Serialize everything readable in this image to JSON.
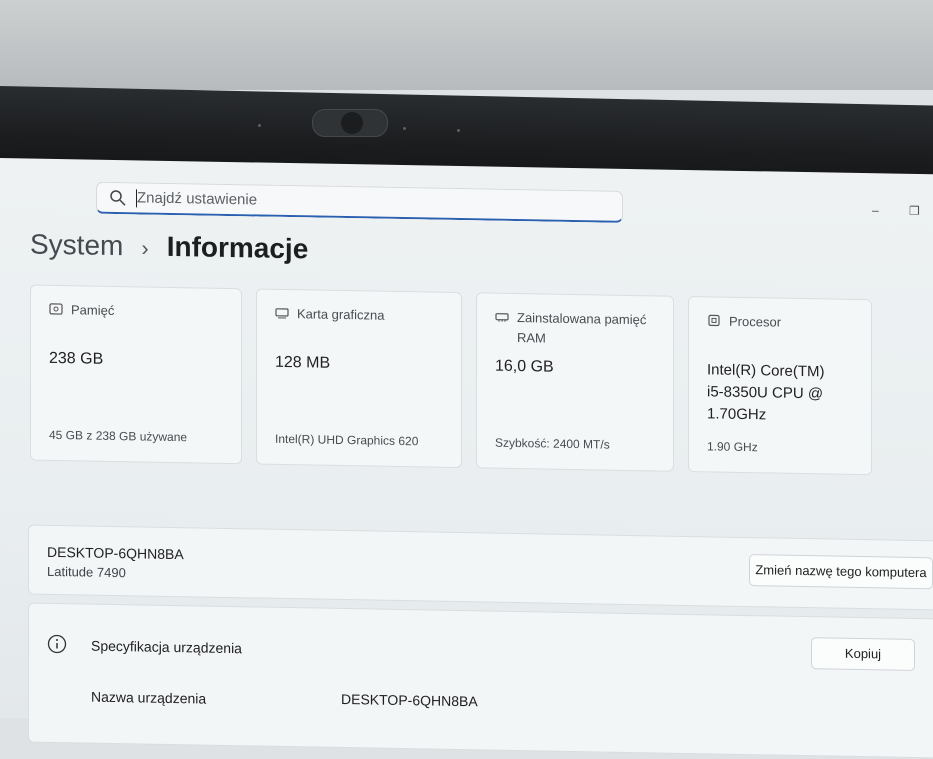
{
  "search": {
    "placeholder": "Znajdź ustawienie"
  },
  "breadcrumb": {
    "root": "System",
    "separator": "›",
    "current": "Informacje"
  },
  "cards": [
    {
      "label": "Pamięć",
      "value": "238 GB",
      "sub": "45 GB z 238 GB używane",
      "icon": "storage-icon"
    },
    {
      "label": "Karta graficzna",
      "value": "128 MB",
      "sub": "Intel(R) UHD Graphics 620",
      "icon": "graphics-card-icon"
    },
    {
      "label": "Zainstalowana pamięć RAM",
      "value": "16,0 GB",
      "sub": "Szybkość: 2400 MT/s",
      "icon": "ram-icon"
    },
    {
      "label": "Procesor",
      "value": "Intel(R) Core(TM) i5-8350U CPU @ 1.70GHz",
      "sub": "1.90 GHz",
      "icon": "processor-icon"
    }
  ],
  "device": {
    "name": "DESKTOP-6QHN8BA",
    "model": "Latitude 7490",
    "rename_button": "Zmień nazwę tego komputera"
  },
  "specs": {
    "title": "Specyfikacja urządzenia",
    "copy_button": "Kopiuj",
    "rows": [
      {
        "label": "Nazwa urządzenia",
        "value": "DESKTOP-6QHN8BA"
      }
    ]
  },
  "window_controls": {
    "minimize": "–",
    "restore": "❐"
  },
  "colors": {
    "accent": "#2b5fb0",
    "card_bg": "#f4f7f8",
    "screen_bg": "#eef2f3"
  }
}
